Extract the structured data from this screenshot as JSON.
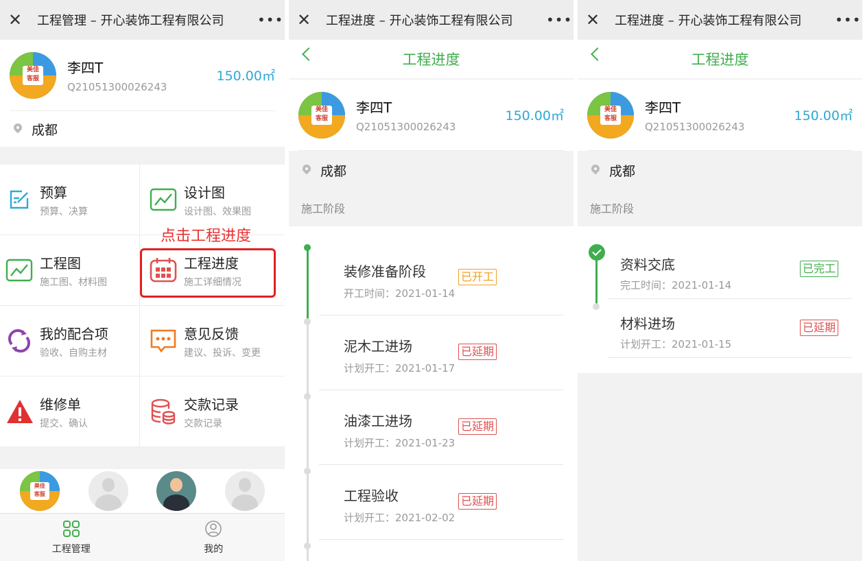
{
  "screen1": {
    "title": "工程管理 – 开心装饰工程有限公司",
    "profile": {
      "name": "李四T",
      "id": "Q21051300026243",
      "area": "150.00",
      "area_unit": "㎡",
      "city": "成都"
    },
    "menu": [
      {
        "title": "预算",
        "sub": "预算、决算",
        "icon": "edit-icon",
        "color": "#2ea9d6"
      },
      {
        "title": "设计图",
        "sub": "设计图、效果图",
        "icon": "chart-line-icon",
        "color": "#3fae4e"
      },
      {
        "title": "工程图",
        "sub": "施工图、材料图",
        "icon": "chart-line-icon",
        "color": "#3fae4e"
      },
      {
        "title": "工程进度",
        "sub": "施工详细情况",
        "icon": "calendar-icon",
        "color": "#e05050"
      },
      {
        "title": "我的配合项",
        "sub": "验收、自购主材",
        "icon": "refresh-icon",
        "color": "#8e44ad"
      },
      {
        "title": "意见反馈",
        "sub": "建议、投诉、变更",
        "icon": "message-icon",
        "color": "#f07a20"
      },
      {
        "title": "维修单",
        "sub": "提交、确认",
        "icon": "warning-icon",
        "color": "#e03030"
      },
      {
        "title": "交款记录",
        "sub": "交款记录",
        "icon": "database-icon",
        "color": "#e05050"
      }
    ],
    "annotation": "点击工程进度",
    "tabs": [
      {
        "label": "工程管理",
        "icon": "grid-icon"
      },
      {
        "label": "我的",
        "icon": "user-icon"
      }
    ]
  },
  "screen2": {
    "title": "工程进度 – 开心装饰工程有限公司",
    "page_title": "工程进度",
    "section": "施工阶段",
    "items": [
      {
        "name": "装修准备阶段",
        "date": "开工时间：2021-01-14",
        "badge": "已开工",
        "status": "started"
      },
      {
        "name": "泥木工进场",
        "date": "计划开工：2021-01-17",
        "badge": "已延期",
        "status": "delayed"
      },
      {
        "name": "油漆工进场",
        "date": "计划开工：2021-01-23",
        "badge": "已延期",
        "status": "delayed"
      },
      {
        "name": "工程验收",
        "date": "计划开工：2021-02-02",
        "badge": "已延期",
        "status": "delayed"
      }
    ]
  },
  "screen3": {
    "title": "工程进度 – 开心装饰工程有限公司",
    "page_title": "工程进度",
    "section": "施工阶段",
    "items": [
      {
        "name": "资料交底",
        "date": "完工时间：2021-01-14",
        "badge": "已完工",
        "status": "done"
      },
      {
        "name": "材料进场",
        "date": "计划开工：2021-01-15",
        "badge": "已延期",
        "status": "delayed"
      }
    ]
  },
  "colors": {
    "accent": "#3fae4e",
    "area": "#2ea9d6",
    "delayed": "#e05050",
    "started": "#f0a020",
    "highlight": "#e02020"
  }
}
